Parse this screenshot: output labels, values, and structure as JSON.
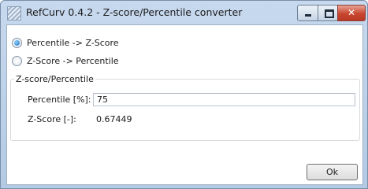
{
  "window": {
    "title": "RefCurv 0.4.2 - Z-score/Percentile converter",
    "close_glyph": "✕"
  },
  "mode": {
    "options": [
      {
        "label": "Percentile -> Z-Score",
        "selected": true
      },
      {
        "label": "Z-Score -> Percentile",
        "selected": false
      }
    ]
  },
  "group": {
    "legend": "Z-score/Percentile",
    "input_label": "Percentile [%]:",
    "input_value": "75",
    "output_label": "Z-Score [-]:",
    "output_value": "0.67449"
  },
  "footer": {
    "ok_label": "Ok"
  }
}
